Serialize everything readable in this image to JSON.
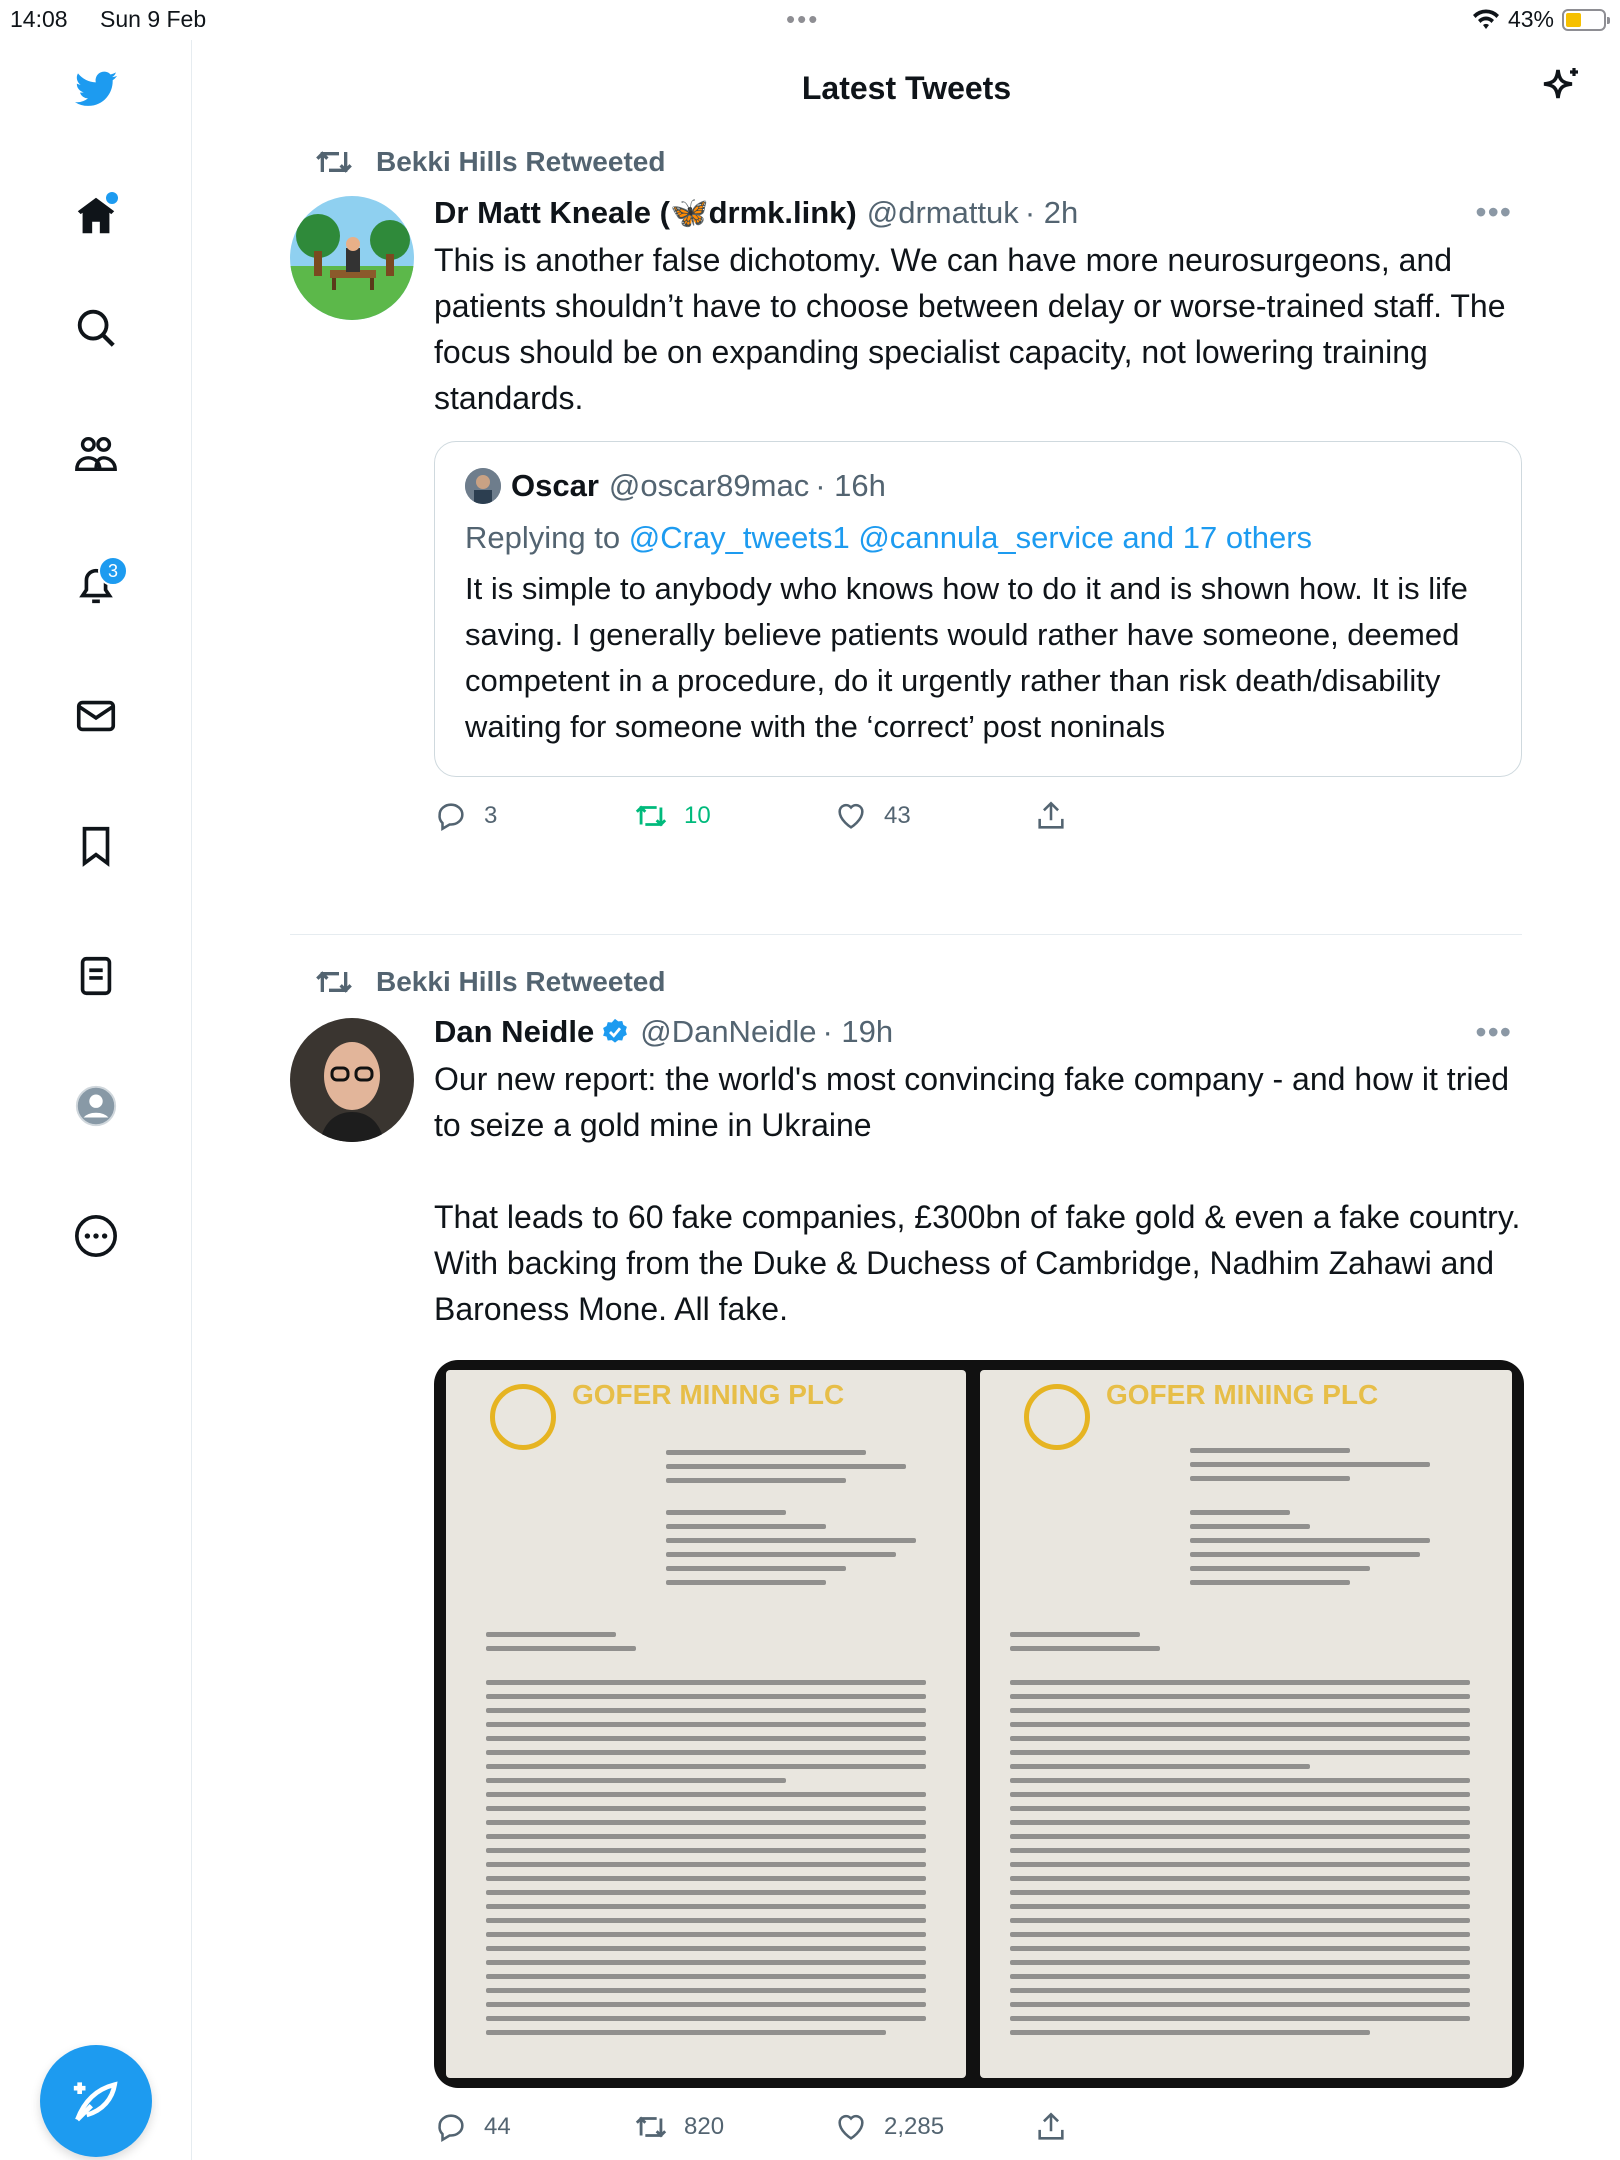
{
  "status": {
    "time": "14:08",
    "date": "Sun 9 Feb",
    "battery": "43%",
    "battery_level": 0.43
  },
  "header": {
    "title": "Latest Tweets"
  },
  "sidebar": {
    "notifications_badge": "3"
  },
  "tweets": [
    {
      "retweeted_by": "Bekki Hills Retweeted",
      "name": "Dr Matt Kneale (🦋drmk.link)",
      "handle": "@drmattuk",
      "time": "· 2h",
      "text": "This is another false dichotomy. We can have more neurosurgeons, and patients shouldn’t have to choose between delay or worse-trained staff. The focus should be on expanding specialist capacity, not lowering training standards.",
      "quote": {
        "name": "Oscar",
        "handle": "@oscar89mac",
        "time": "· 16h",
        "replying_prefix": "Replying to ",
        "replying_to": "@Cray_tweets1 @cannula_service and 17 others",
        "text": "It is simple to anybody who knows how to do it and is shown how. It is life saving. I generally believe patients would rather have someone, deemed competent in a procedure, do it urgently rather than risk death/disability waiting for someone with the ‘correct’ post noninals"
      },
      "replies": "3",
      "retweets": "10",
      "likes": "43"
    },
    {
      "retweeted_by": "Bekki Hills Retweeted",
      "name": "Dan Neidle",
      "handle": "@DanNeidle",
      "time": "· 19h",
      "text": "Our new report: the world's most convincing fake company - and how it tried to seize a gold mine in Ukraine\n\nThat leads to 60 fake companies, £300bn of fake gold & even a fake country. With backing from the Duke & Duchess of Cambridge, Nadhim Zahawi and Baroness Mone. All fake.",
      "media": {
        "left_logo": "GOFER MINING PLC",
        "right_logo": "GOFER MINING PLC"
      },
      "replies": "44",
      "retweets": "820",
      "likes": "2,285"
    }
  ],
  "colors": {
    "accent": "#1d9bf0",
    "muted": "#536471",
    "retweet_green": "#00ba7c"
  }
}
